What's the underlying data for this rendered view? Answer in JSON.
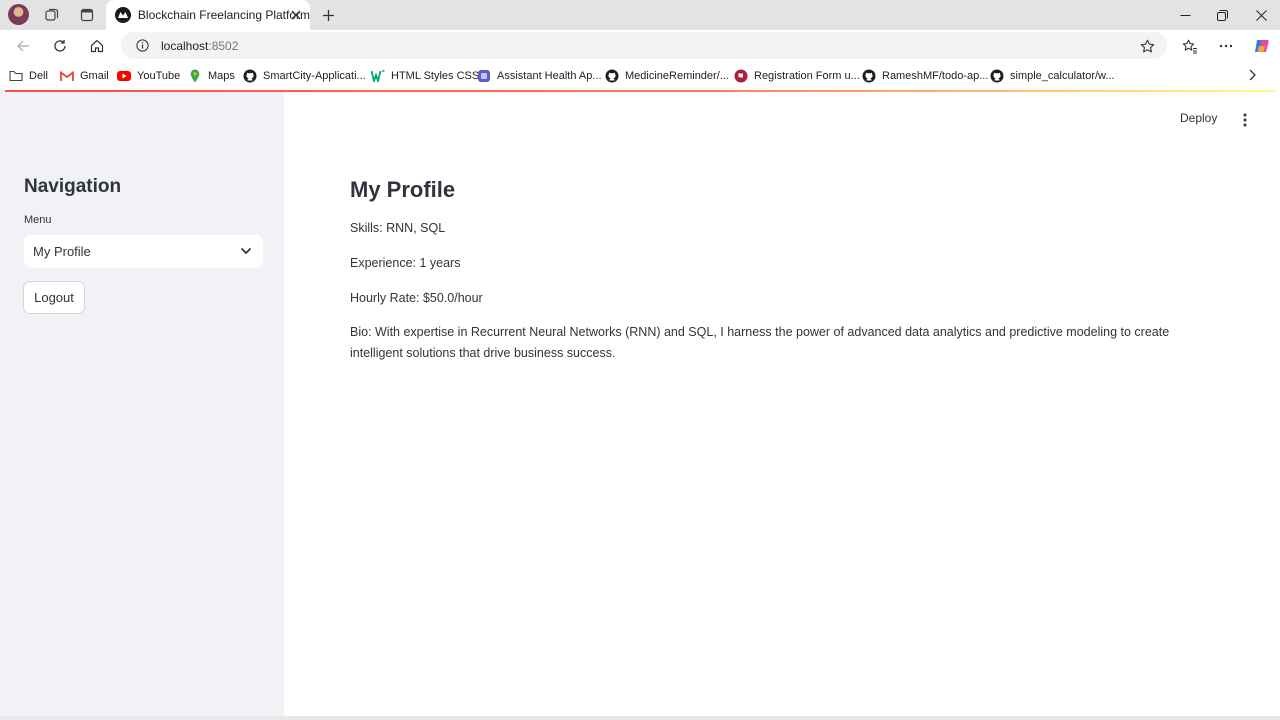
{
  "browser": {
    "tab_title": "Blockchain Freelancing Platform",
    "url_host": "localhost",
    "url_port": ":8502",
    "bookmarks": [
      {
        "label": "Dell",
        "icon": "folder-icon"
      },
      {
        "label": "Gmail",
        "icon": "gmail-icon",
        "color": "#ea4335"
      },
      {
        "label": "YouTube",
        "icon": "youtube-icon",
        "color": "#ff0000"
      },
      {
        "label": "Maps",
        "icon": "maps-icon",
        "color": "#34a853"
      },
      {
        "label": "SmartCity-Applicati...",
        "icon": "github-icon"
      },
      {
        "label": "HTML Styles CSS",
        "icon": "w3schools-icon",
        "color": "#04aa6d"
      },
      {
        "label": "Assistant Health Ap...",
        "icon": "app-icon",
        "color": "#5b5fc7"
      },
      {
        "label": "MedicineReminder/...",
        "icon": "github-icon"
      },
      {
        "label": "Registration Form u...",
        "icon": "site-icon",
        "color": "#b01e3c"
      },
      {
        "label": "RameshMF/todo-ap...",
        "icon": "github-icon"
      },
      {
        "label": "simple_calculator/w...",
        "icon": "github-icon"
      }
    ]
  },
  "app": {
    "deploy_label": "Deploy",
    "sidebar": {
      "heading": "Navigation",
      "menu_label": "Menu",
      "menu_selected": "My Profile",
      "logout_label": "Logout"
    },
    "profile": {
      "title": "My Profile",
      "skills": "Skills: RNN, SQL",
      "experience": "Experience: 1 years",
      "hourly_rate": "Hourly Rate: $50.0/hour",
      "bio": "Bio: With expertise in Recurrent Neural Networks (RNN) and SQL, I harness the power of advanced data analytics and predictive modeling to create intelligent solutions that drive business success."
    }
  },
  "colors": {
    "sidebar_bg": "#f0f2f6",
    "text": "#31333f",
    "accent_red": "#ff4b4b"
  }
}
